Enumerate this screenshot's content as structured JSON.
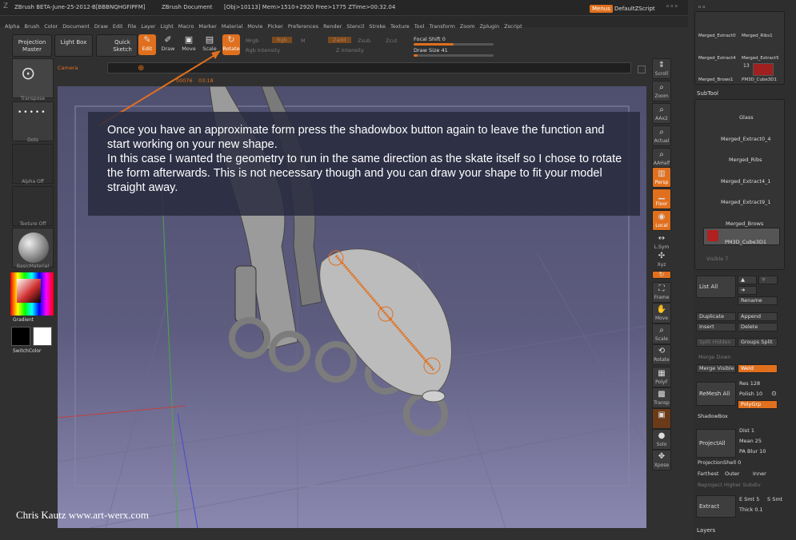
{
  "title_bar": {
    "app": "ZBrush BETA-June-25-2012-B[BBBNQHGFIPFM]",
    "document": "ZBrush Document",
    "stats": "[Obj>10113] Mem>1510+2920 Free>1775 ZTime>00:32.04",
    "menus_label": "Menus",
    "script_label": "DefaultZScript"
  },
  "menu_items": [
    "Alpha",
    "Brush",
    "Color",
    "Document",
    "Draw",
    "Edit",
    "File",
    "Layer",
    "Light",
    "Macro",
    "Marker",
    "Material",
    "Movie",
    "Picker",
    "Preferences",
    "Render",
    "Stencil",
    "Stroke",
    "Texture",
    "Tool",
    "Transform",
    "Zoom",
    "Zplugin",
    "Zscript"
  ],
  "toolbar": {
    "projection_master": "Projection Master",
    "light_box": "Light Box",
    "quick_sketch": "Quick Sketch",
    "edit": "Edit",
    "draw": "Draw",
    "move": "Move",
    "scale": "Scale",
    "rotate": "Rotate",
    "mrgb": "Mrgb",
    "rgb": "Rgb",
    "m": "M",
    "zadd": "Zadd",
    "zsub": "Zsub",
    "zcut": "Zcut",
    "rgb_intensity": "Rgb Intensity",
    "z_intensity": "Z Intensity",
    "focal_shift_label": "Focal Shift",
    "focal_shift_value": "0",
    "draw_size_label": "Draw Size",
    "draw_size_value": "41",
    "focal_shift_level": 0.5,
    "draw_size_level": 0.05
  },
  "timeline": {
    "camera_label": "Camera",
    "frame": "00076",
    "time": "03:18"
  },
  "left_panel": {
    "transpose": "Transpose",
    "dots": "Dots",
    "alpha_off": "Alpha Off",
    "texture_off": "Texture Off",
    "material": "BasicMaterial",
    "gradient": "Gradient",
    "switch_color": "SwitchColor"
  },
  "right_tools": [
    "Scroll",
    "Zoom",
    "AAx2",
    "Actual",
    "AAHalf",
    "Persp",
    "Floor",
    "Local",
    "L.Sym",
    "Xyz",
    "",
    "",
    "Frame",
    "Move",
    "Scale",
    "Rotate",
    "PolyF",
    "Transp",
    "Ghost",
    "Solo",
    "Xpose"
  ],
  "tool_palette": {
    "thumbs": [
      "Merged_Extract0",
      "Merged_Ribs1",
      "Merged_Extract4",
      "Merged_Extract5",
      "Merged_Brows1",
      "PM3D_Cube3D1"
    ],
    "thumb_count": "13"
  },
  "subtool": {
    "header": "SubTool",
    "items": [
      "Glass",
      "Merged_Extract0_4",
      "Merged_Ribs",
      "Merged_Extract4_1",
      "Merged_Extract9_1",
      "Merged_Brows",
      "PM3D_Cube3D1"
    ],
    "visible_label": "Visible 7",
    "list_all": "List All",
    "rename": "Rename",
    "duplicate": "Duplicate",
    "append": "Append",
    "insert": "Insert",
    "delete": "Delete",
    "split_hidden": "Split Hidden",
    "groups_split": "Groups Split",
    "merge_down": "Merge Down",
    "merge_visible": "Merge Visible",
    "weld": "Weld",
    "remesh_all": "ReMesh All",
    "res_label": "Res",
    "res_value": "128",
    "polish_label": "Polish",
    "polish_value": "10",
    "polygrp": "PolyGrp",
    "shadowbox": "ShadowBox",
    "project_all": "ProjectAll",
    "dist_label": "Dist",
    "dist_value": "1",
    "mean_label": "Mean",
    "mean_value": "25",
    "pa_blur_label": "PA Blur",
    "pa_blur_value": "10",
    "projection_shell_label": "ProjectionShell",
    "projection_shell_value": "0",
    "farthest": "Farthest",
    "outer": "Outer",
    "inner": "Inner",
    "reproject": "Reproject Higher Subdiv",
    "extract": "Extract",
    "e_smt": "E Smt",
    "e_smt_value": "5",
    "s_smt": "S Smt",
    "thick_label": "Thick",
    "thick_value": "0.1",
    "layers": "Layers"
  },
  "callout": {
    "text_1": "Once you have an approximate form press the shadowbox button again to leave the function and start working on your new shape.",
    "text_2": "In this case I wanted the geometry to run in the same direction as the skate itself so I chose to rotate the form afterwards. This is not necessary though and you can draw your shape to fit your model straight away."
  },
  "credit": "Chris Kautz www.art-werx.com",
  "colors": {
    "accent": "#e0701e",
    "viewport_top": "#4f4f6f",
    "viewport_bottom": "#8b88b0"
  }
}
